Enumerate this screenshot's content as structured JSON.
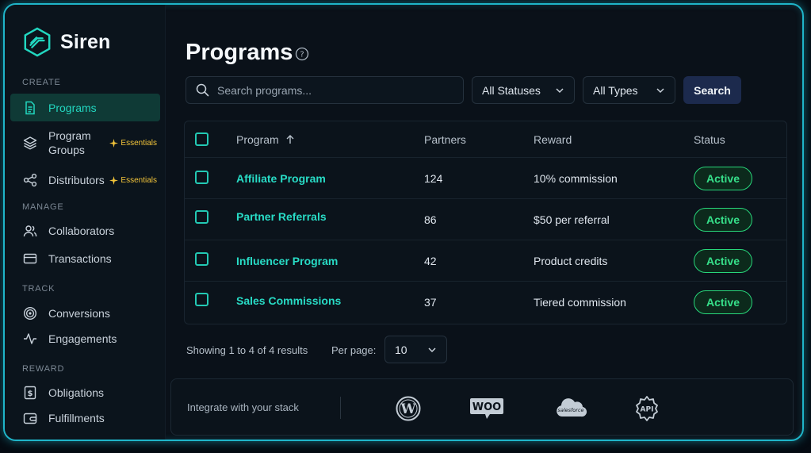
{
  "brand": {
    "name": "Siren"
  },
  "sidebar": {
    "sections": {
      "create": "CREATE",
      "manage": "MANAGE",
      "track": "TRACK",
      "reward": "REWARD"
    },
    "items": [
      {
        "label": "Programs",
        "icon": "document-icon",
        "active": true
      },
      {
        "label": "Program Groups",
        "icon": "layers-icon",
        "badge": "Essentials"
      },
      {
        "label": "Distributors",
        "icon": "share-nodes-icon",
        "badge": "Essentials"
      },
      {
        "label": "Collaborators",
        "icon": "users-icon"
      },
      {
        "label": "Transactions",
        "icon": "credit-card-icon"
      },
      {
        "label": "Conversions",
        "icon": "target-icon"
      },
      {
        "label": "Engagements",
        "icon": "activity-icon"
      },
      {
        "label": "Obligations",
        "icon": "dollar-doc-icon"
      },
      {
        "label": "Fulfillments",
        "icon": "wallet-icon"
      }
    ]
  },
  "header": {
    "title": "Programs"
  },
  "filters": {
    "search_placeholder": "Search programs...",
    "status": "All Statuses",
    "type": "All Types",
    "search_button": "Search"
  },
  "table": {
    "columns": {
      "program": "Program",
      "partners": "Partners",
      "reward": "Reward",
      "status": "Status"
    },
    "rows": [
      {
        "program": "Affiliate Program",
        "partners": "124",
        "reward": "10% commission",
        "status": "Active"
      },
      {
        "program": "Partner Referrals",
        "partners": "86",
        "reward": "$50 per referral",
        "status": "Active"
      },
      {
        "program": "Influencer Program",
        "partners": "42",
        "reward": "Product credits",
        "status": "Active"
      },
      {
        "program": "Sales Commissions",
        "partners": "37",
        "reward": "Tiered commission",
        "status": "Active"
      }
    ]
  },
  "pagination": {
    "showing": "Showing 1 to 4 of 4 results",
    "per_page_label": "Per page:",
    "per_page_value": "10"
  },
  "integrations": {
    "label": "Integrate with your stack",
    "logos": {
      "woo": "WOO",
      "salesforce": "salesforce",
      "api": "API"
    }
  },
  "colors": {
    "accent": "#22d7c0",
    "active_green": "#36e08a",
    "badge_yellow": "#f3c53a",
    "frame_glow": "#1fb5c9"
  }
}
